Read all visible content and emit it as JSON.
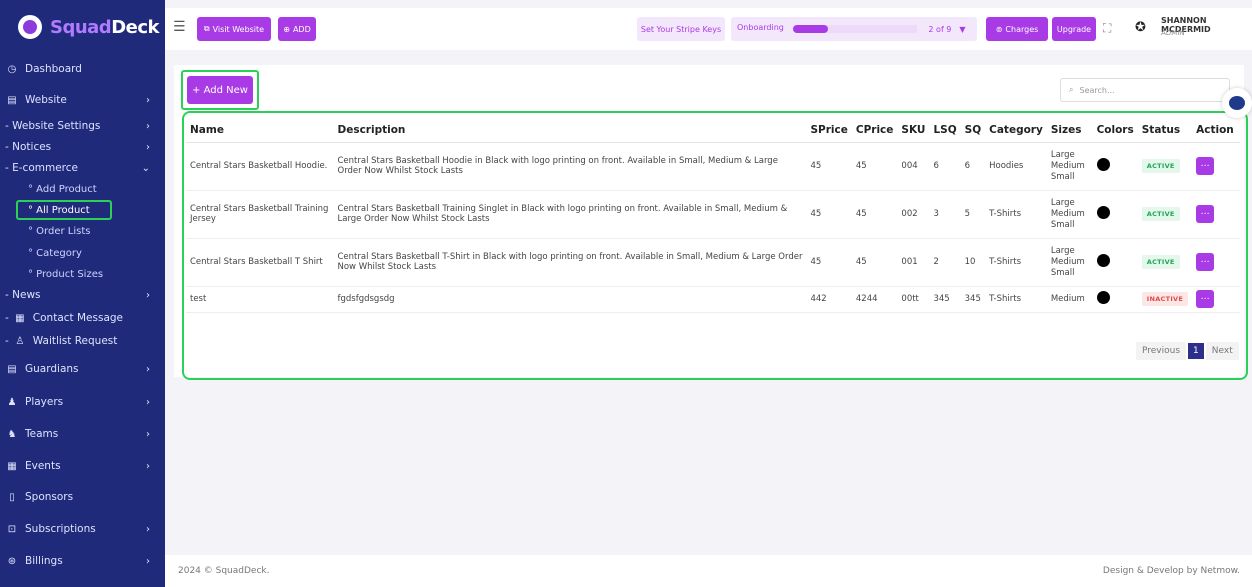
{
  "brand": {
    "squad": "Squad",
    "deck": "Deck"
  },
  "topbar": {
    "visit_website": "Visit Website",
    "add": "ADD",
    "stripe_keys": "Set Your Stripe Keys",
    "onboarding": "Onboarding",
    "onboarding_progress": 0.25,
    "steps": "2 of 9",
    "charges": "Charges",
    "upgrade": "Upgrade",
    "user_name": "SHANNON MCDERMID",
    "user_role": "ADMIN"
  },
  "sidebar": {
    "items": [
      {
        "label": "Dashboard",
        "icon": "dashboard-icon"
      },
      {
        "label": "Website",
        "icon": "website-icon"
      },
      {
        "label": "- Website Settings"
      },
      {
        "label": "- Notices"
      },
      {
        "label": "- E-commerce"
      },
      {
        "label": "° Add Product"
      },
      {
        "label": "° All Product"
      },
      {
        "label": "° Order Lists"
      },
      {
        "label": "° Category"
      },
      {
        "label": "° Product Sizes"
      },
      {
        "label": "- News"
      },
      {
        "label": "Contact Message"
      },
      {
        "label": "Waitlist Request"
      },
      {
        "label": "Guardians"
      },
      {
        "label": "Players"
      },
      {
        "label": "Teams"
      },
      {
        "label": "Events"
      },
      {
        "label": "Sponsors"
      },
      {
        "label": "Subscriptions"
      },
      {
        "label": "Billings"
      }
    ]
  },
  "main": {
    "add_new": "+ Add New",
    "search_placeholder": "Search...",
    "columns": [
      "Name",
      "Description",
      "SPrice",
      "CPrice",
      "SKU",
      "LSQ",
      "SQ",
      "Category",
      "Sizes",
      "Colors",
      "Status",
      "Action"
    ],
    "rows": [
      {
        "name": "Central Stars Basketball Hoodie.",
        "description": "Central Stars Basketball Hoodie in Black with logo printing on front. Available in Small, Medium & Large Order Now Whilst Stock Lasts",
        "sprice": "45",
        "cprice": "45",
        "sku": "004",
        "lsq": "6",
        "sq": "6",
        "category": "Hoodies",
        "sizes": "Large\nMedium\nSmall",
        "status": "ACTIVE"
      },
      {
        "name": "Central Stars Basketball Training Jersey",
        "description": "Central Stars Basketball Training Singlet in Black with logo printing on front. Available in Small, Medium & Large Order Now Whilst Stock Lasts",
        "sprice": "45",
        "cprice": "45",
        "sku": "002",
        "lsq": "3",
        "sq": "5",
        "category": "T-Shirts",
        "sizes": "Large\nMedium\nSmall",
        "status": "ACTIVE"
      },
      {
        "name": "Central Stars Basketball T Shirt",
        "description": "Central Stars Basketball T-Shirt in Black with logo printing on front. Available in Small, Medium & Large Order Now Whilst Stock Lasts",
        "sprice": "45",
        "cprice": "45",
        "sku": "001",
        "lsq": "2",
        "sq": "10",
        "category": "T-Shirts",
        "sizes": "Large\nMedium\nSmall",
        "status": "ACTIVE"
      },
      {
        "name": "test",
        "description": "fgdsfgdsgsdg",
        "sprice": "442",
        "cprice": "4244",
        "sku": "00tt",
        "lsq": "345",
        "sq": "345",
        "category": "T-Shirts",
        "sizes": "Medium",
        "status": "INACTIVE"
      }
    ],
    "pager": {
      "previous": "Previous",
      "current": "1",
      "next": "Next"
    }
  },
  "footer": {
    "left": "2024 © SquadDeck.",
    "right": "Design & Develop by Netmow."
  },
  "colors": {
    "sidebar": "#1f2a7a",
    "accent": "#a93be6",
    "highlight": "#2bd156"
  }
}
